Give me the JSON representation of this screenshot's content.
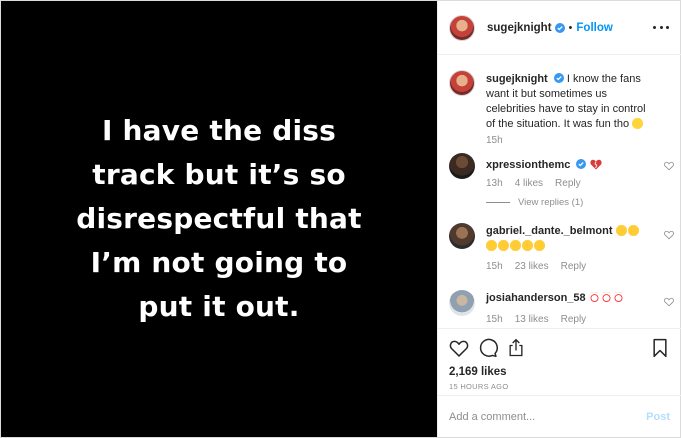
{
  "media": {
    "text": "I have the diss\ntrack but it’s so\ndisrespectful that\nI’m not going to\nput it out."
  },
  "header": {
    "username": "sugejknight",
    "separator": "•",
    "follow_label": "Follow"
  },
  "caption": {
    "username": "sugejknight",
    "text": "I know the fans want it but sometimes us celebrities have to stay in control of the situation. It was fun tho",
    "emoji": "slightly-smiling-face",
    "time": "15h"
  },
  "comments": [
    {
      "username": "xpressionthemc",
      "text": "",
      "emoji": "broken-heart",
      "time": "13h",
      "likes": "4 likes",
      "reply_label": "Reply",
      "view_replies": "View replies (1)"
    },
    {
      "username": "gabriel._dante._belmont",
      "text": "",
      "emoji": "face-with-tears-of-joy x7",
      "time": "15h",
      "likes": "23 likes",
      "reply_label": "Reply"
    },
    {
      "username": "josiahanderson_58",
      "text": "",
      "emoji": "clown-face x3",
      "time": "15h",
      "likes": "13 likes",
      "reply_label": "Reply"
    }
  ],
  "actions": {
    "icons": [
      "heart-icon",
      "comment-icon",
      "share-icon",
      "bookmark-icon"
    ],
    "likes_count": "2,169 likes",
    "timestamp": "15 HOURS AGO"
  },
  "add_comment": {
    "placeholder": "Add a comment...",
    "post_label": "Post"
  },
  "colors": {
    "follow_blue": "#0095f6",
    "verified_blue": "#3897f0",
    "muted_text": "#8e8e8e",
    "post_disabled": "#b2dffc"
  }
}
